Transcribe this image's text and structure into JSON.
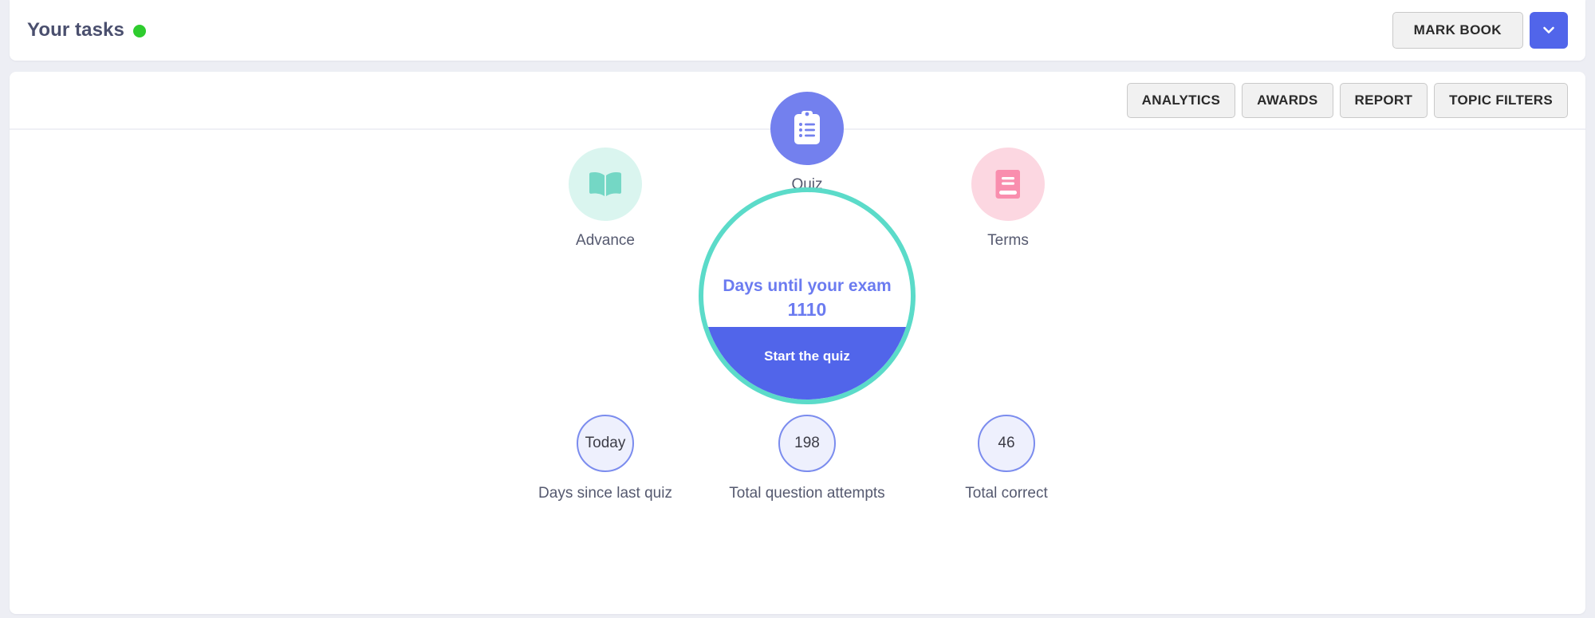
{
  "header": {
    "title": "Your tasks",
    "status_dot_color": "#2ecc2e",
    "mark_book_label": "MARK BOOK",
    "dropdown_icon": "chevron-down-icon",
    "dropdown_color": "#5165ea"
  },
  "toolbar": {
    "tabs": [
      {
        "label": "ANALYTICS"
      },
      {
        "label": "AWARDS"
      },
      {
        "label": "REPORT"
      },
      {
        "label": "TOPIC FILTERS"
      }
    ]
  },
  "dashboard": {
    "shortcuts": [
      {
        "label": "Advance",
        "icon": "open-book-icon",
        "bubble_color": "#daf5ef",
        "glyph_color": "#74d7c5"
      },
      {
        "label": "Quiz",
        "icon": "clipboard-list-icon",
        "bubble_color": "#7380ee",
        "glyph_color": "#ffffff"
      },
      {
        "label": "Terms",
        "icon": "closed-book-icon",
        "bubble_color": "#fcd7e1",
        "glyph_color": "#f princess"
      }
    ],
    "hero": {
      "title": "Days until your exam",
      "value": "1110",
      "cta": "Start the quiz",
      "ring_color": "#5bdbc9",
      "fill_color": "#5165ea",
      "text_color": "#6b7bf0"
    },
    "stats": [
      {
        "value": "Today",
        "label": "Days since last quiz"
      },
      {
        "value": "198",
        "label": "Total question attempts"
      },
      {
        "value": "46",
        "label": "Total correct"
      }
    ]
  }
}
